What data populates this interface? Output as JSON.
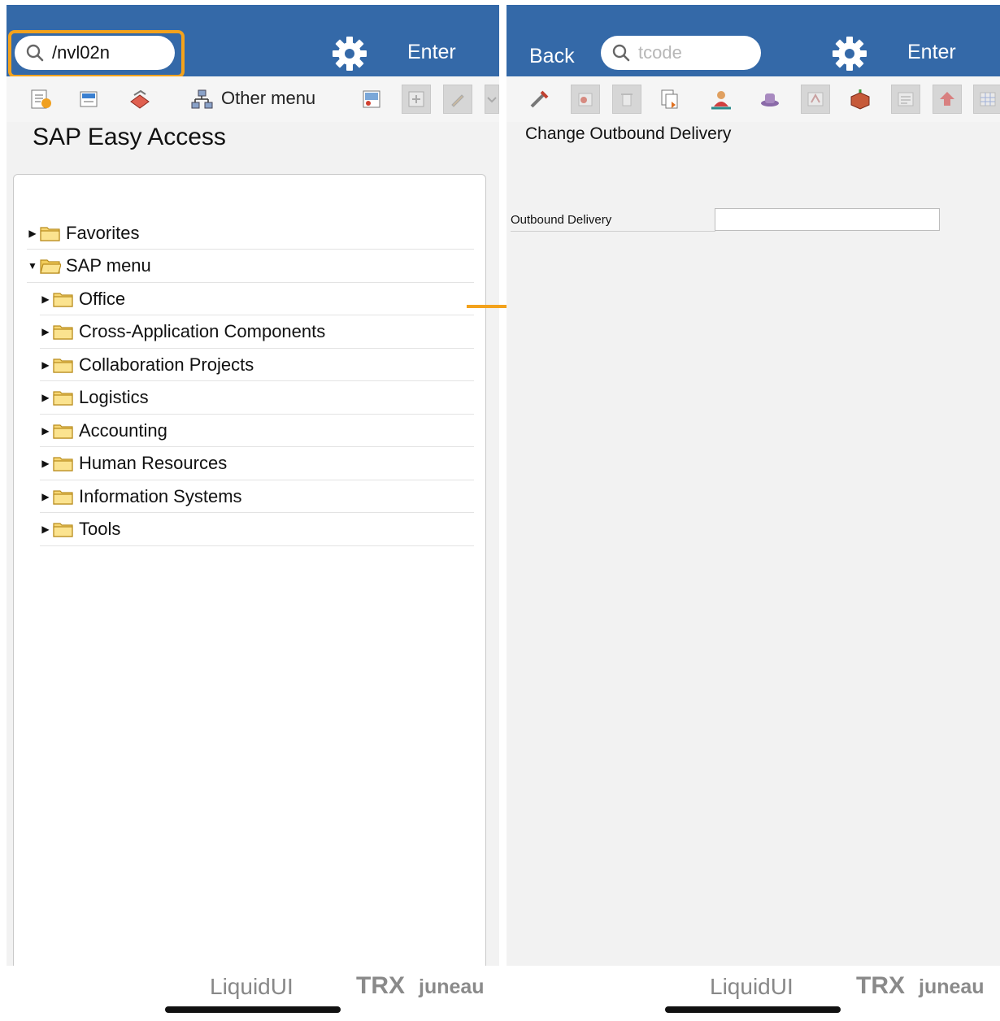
{
  "left": {
    "search": {
      "value": "/nvl02n"
    },
    "enter_label": "Enter",
    "toolbar": {
      "other_menu_label": "Other menu"
    },
    "title": "SAP Easy Access",
    "tree": [
      {
        "label": "Favorites",
        "expanded": false,
        "level": 0
      },
      {
        "label": "SAP menu",
        "expanded": true,
        "level": 0
      },
      {
        "label": "Office",
        "expanded": false,
        "level": 1
      },
      {
        "label": "Cross-Application Components",
        "expanded": false,
        "level": 1
      },
      {
        "label": "Collaboration Projects",
        "expanded": false,
        "level": 1
      },
      {
        "label": "Logistics",
        "expanded": false,
        "level": 1
      },
      {
        "label": "Accounting",
        "expanded": false,
        "level": 1
      },
      {
        "label": "Human Resources",
        "expanded": false,
        "level": 1
      },
      {
        "label": "Information Systems",
        "expanded": false,
        "level": 1
      },
      {
        "label": "Tools",
        "expanded": false,
        "level": 1
      }
    ],
    "footer": {
      "brand": "LiquidUI",
      "trx": "TRX",
      "juneau": "juneau"
    }
  },
  "right": {
    "back_label": "Back",
    "search": {
      "placeholder": "tcode"
    },
    "enter_label": "Enter",
    "title": "Change Outbound Delivery",
    "field": {
      "label": "Outbound Delivery",
      "value": ""
    },
    "footer": {
      "brand": "LiquidUI",
      "trx": "TRX",
      "juneau": "juneau"
    }
  },
  "colors": {
    "header": "#3469a8",
    "highlight": "#f3a21c",
    "arrow": "#f3a21c"
  },
  "icons": {
    "left_toolbar": [
      "create-favorite-icon",
      "change-favorite-icon",
      "delete-favorite-icon",
      "other-menu-icon",
      "add-folder-icon",
      "move-icon",
      "edit-icon",
      "overflow-icon"
    ],
    "right_toolbar": [
      "tools-icon",
      "delete-icon",
      "trash-icon",
      "copy-icon",
      "partner-icon",
      "hat-icon",
      "text-icon",
      "package-icon",
      "list-icon",
      "up-arrow-icon",
      "grid-icon"
    ]
  }
}
